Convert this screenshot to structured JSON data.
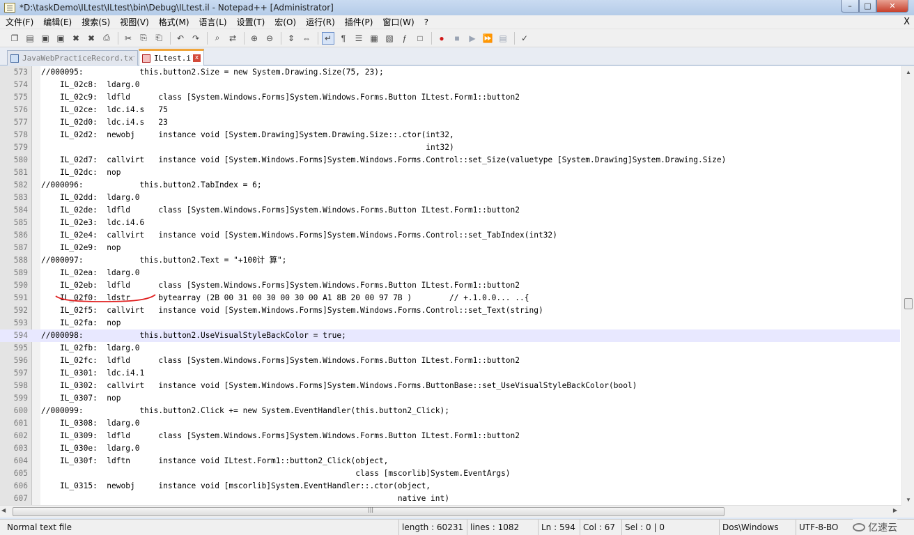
{
  "window": {
    "title": "*D:\\taskDemo\\ILtest\\ILtest\\bin\\Debug\\ILtest.il - Notepad++ [Administrator]",
    "minimize": "–",
    "maximize": "□",
    "close": "✕"
  },
  "menu": {
    "items": [
      "文件(F)",
      "编辑(E)",
      "搜索(S)",
      "视图(V)",
      "格式(M)",
      "语言(L)",
      "设置(T)",
      "宏(O)",
      "运行(R)",
      "插件(P)",
      "窗口(W)",
      "?"
    ],
    "close_label": "X"
  },
  "toolbar": {
    "icons": [
      "new-file-icon",
      "open-file-icon",
      "save-icon",
      "save-all-icon",
      "close-icon",
      "close-all-icon",
      "print-icon",
      "cut-icon",
      "copy-icon",
      "paste-icon",
      "undo-icon",
      "redo-icon",
      "find-icon",
      "replace-icon",
      "zoom-in-icon",
      "zoom-out-icon",
      "sync-vertical-icon",
      "sync-horizontal-icon",
      "word-wrap-icon",
      "show-all-chars-icon",
      "indent-guide-icon",
      "user-lang-icon",
      "doc-map-icon",
      "function-list-icon",
      "folder-workspace-icon",
      "record-macro-icon",
      "stop-record-icon",
      "play-macro-icon",
      "run-macro-multiple-icon",
      "save-macro-icon",
      "spellcheck-icon"
    ],
    "glyphs": [
      "❐",
      "▤",
      "▣",
      "▣",
      "✖",
      "✖",
      "⎙",
      "✂",
      "⎘",
      "⎗",
      "↶",
      "↷",
      "⌕",
      "⇄",
      "⊕",
      "⊖",
      "⇕",
      "⇔",
      "↵",
      "¶",
      "☰",
      "▦",
      "▧",
      "ƒ",
      "□",
      "●",
      "■",
      "▶",
      "⏩",
      "▤",
      "✓"
    ]
  },
  "tabs": [
    {
      "label": "JavaWebPracticeRecord.txt",
      "close": "x"
    },
    {
      "label": "ILtest.il",
      "close": "x"
    }
  ],
  "editor": {
    "lines": [
      {
        "n": "573",
        "t": "//000095:            this.button2.Size = new System.Drawing.Size(75, 23);"
      },
      {
        "n": "574",
        "t": "    IL_02c8:  ldarg.0"
      },
      {
        "n": "575",
        "t": "    IL_02c9:  ldfld      class [System.Windows.Forms]System.Windows.Forms.Button ILtest.Form1::button2"
      },
      {
        "n": "576",
        "t": "    IL_02ce:  ldc.i4.s   75"
      },
      {
        "n": "577",
        "t": "    IL_02d0:  ldc.i4.s   23"
      },
      {
        "n": "578",
        "t": "    IL_02d2:  newobj     instance void [System.Drawing]System.Drawing.Size::.ctor(int32,"
      },
      {
        "n": "579",
        "t": "                                                                                  int32)"
      },
      {
        "n": "580",
        "t": "    IL_02d7:  callvirt   instance void [System.Windows.Forms]System.Windows.Forms.Control::set_Size(valuetype [System.Drawing]System.Drawing.Size)"
      },
      {
        "n": "581",
        "t": "    IL_02dc:  nop"
      },
      {
        "n": "582",
        "t": "//000096:            this.button2.TabIndex = 6;"
      },
      {
        "n": "583",
        "t": "    IL_02dd:  ldarg.0"
      },
      {
        "n": "584",
        "t": "    IL_02de:  ldfld      class [System.Windows.Forms]System.Windows.Forms.Button ILtest.Form1::button2"
      },
      {
        "n": "585",
        "t": "    IL_02e3:  ldc.i4.6"
      },
      {
        "n": "586",
        "t": "    IL_02e4:  callvirt   instance void [System.Windows.Forms]System.Windows.Forms.Control::set_TabIndex(int32)"
      },
      {
        "n": "587",
        "t": "    IL_02e9:  nop"
      },
      {
        "n": "588",
        "t": "//000097:            this.button2.Text = \"+100计 算\";"
      },
      {
        "n": "589",
        "t": "    IL_02ea:  ldarg.0"
      },
      {
        "n": "590",
        "t": "    IL_02eb:  ldfld      class [System.Windows.Forms]System.Windows.Forms.Button ILtest.Form1::button2"
      },
      {
        "n": "591",
        "t": "    IL_02f0:  ldstr      bytearray (2B 00 31 00 30 00 30 00 A1 8B 20 00 97 7B )        // +.1.0.0... ..{"
      },
      {
        "n": "592",
        "t": "    IL_02f5:  callvirt   instance void [System.Windows.Forms]System.Windows.Forms.Control::set_Text(string)"
      },
      {
        "n": "593",
        "t": "    IL_02fa:  nop"
      },
      {
        "n": "594",
        "t": "//000098:            this.button2.UseVisualStyleBackColor = true;"
      },
      {
        "n": "595",
        "t": "    IL_02fb:  ldarg.0"
      },
      {
        "n": "596",
        "t": "    IL_02fc:  ldfld      class [System.Windows.Forms]System.Windows.Forms.Button ILtest.Form1::button2"
      },
      {
        "n": "597",
        "t": "    IL_0301:  ldc.i4.1"
      },
      {
        "n": "598",
        "t": "    IL_0302:  callvirt   instance void [System.Windows.Forms]System.Windows.Forms.ButtonBase::set_UseVisualStyleBackColor(bool)"
      },
      {
        "n": "599",
        "t": "    IL_0307:  nop"
      },
      {
        "n": "600",
        "t": "//000099:            this.button2.Click += new System.EventHandler(this.button2_Click);"
      },
      {
        "n": "601",
        "t": "    IL_0308:  ldarg.0"
      },
      {
        "n": "602",
        "t": "    IL_0309:  ldfld      class [System.Windows.Forms]System.Windows.Forms.Button ILtest.Form1::button2"
      },
      {
        "n": "603",
        "t": "    IL_030e:  ldarg.0"
      },
      {
        "n": "604",
        "t": "    IL_030f:  ldftn      instance void ILtest.Form1::button2_Click(object,"
      },
      {
        "n": "605",
        "t": "                                                                   class [mscorlib]System.EventArgs)"
      },
      {
        "n": "606",
        "t": "    IL_0315:  newobj     instance void [mscorlib]System.EventHandler::.ctor(object,"
      },
      {
        "n": "607",
        "t": "                                                                            native int)"
      }
    ],
    "current_line": "594",
    "annotation_color": "#e02020"
  },
  "statusbar": {
    "file_type": "Normal text file",
    "length": "length : 60231",
    "lines": "lines : 1082",
    "ln": "Ln : 594",
    "col": "Col : 67",
    "sel": "Sel : 0 | 0",
    "eol": "Dos\\Windows",
    "encoding": "UTF-8-BO"
  },
  "watermark": {
    "text": "亿速云"
  }
}
